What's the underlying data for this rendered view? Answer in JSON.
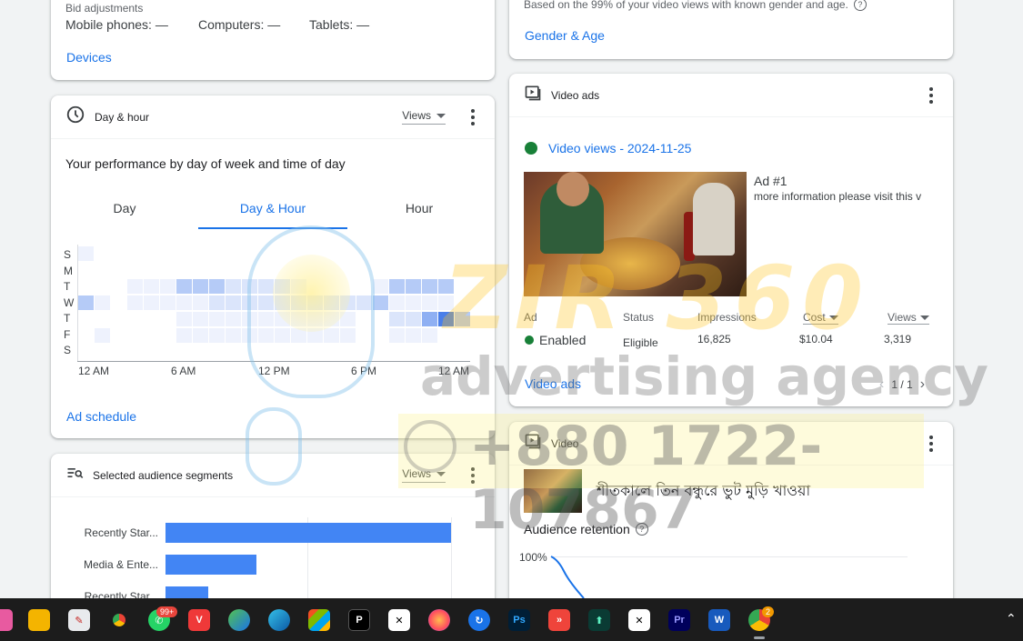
{
  "devices_card": {
    "bid_label": "Bid adjustments",
    "mobile": "Mobile phones: —",
    "computers": "Computers: —",
    "tablets": "Tablets: —",
    "link": "Devices"
  },
  "gender_card": {
    "note": "Based on the 99% of your video views with known gender and age.",
    "link": "Gender & Age"
  },
  "day_hour_card": {
    "title": "Day & hour",
    "metric": "Views",
    "subtitle": "Your performance by day of week and time of day",
    "tabs": [
      "Day",
      "Day & Hour",
      "Hour"
    ],
    "active_tab": "Day & Hour",
    "days": [
      "S",
      "M",
      "T",
      "W",
      "T",
      "F",
      "S"
    ],
    "x_ticks": [
      "12 AM",
      "6 AM",
      "12 PM",
      "6 PM",
      "12 AM"
    ],
    "link": "Ad schedule"
  },
  "audience_card": {
    "title": "Selected audience segments",
    "metric": "Views",
    "bars": [
      {
        "label": "Recently Star...",
        "value": 1.0
      },
      {
        "label": "Media & Ente...",
        "value": 0.32
      },
      {
        "label": "Recently Star...",
        "value": 0.15
      }
    ]
  },
  "video_ads_card": {
    "title": "Video ads",
    "headline": "Video views - 2024-11-25",
    "ad_name": "Ad #1",
    "ad_desc": "more information please visit this v",
    "columns": [
      "Ad",
      "Status",
      "Impressions",
      "Cost",
      "Views"
    ],
    "row": {
      "ad": "Enabled",
      "status": "Eligible",
      "impressions": "16,825",
      "cost": "$10.04",
      "views": "3,319"
    },
    "link": "Video ads",
    "pager": "1 / 1"
  },
  "video_card": {
    "title": "Video",
    "video_title": "শীতকালে তিন বন্ধুরে ভুট মুড়ি খাওয়া",
    "retention_label": "Audience retention",
    "retention_tick": "100%"
  },
  "watermark": {
    "line1": "ZIR 360",
    "line2": "advertising agency",
    "phone": "+880 1722-107867"
  },
  "taskbar": {
    "whatsapp_badge": "99+",
    "chrome_badge": "2"
  },
  "colors": {
    "accent": "#1a73e8",
    "green": "#188038",
    "bar": "#4285f4"
  }
}
